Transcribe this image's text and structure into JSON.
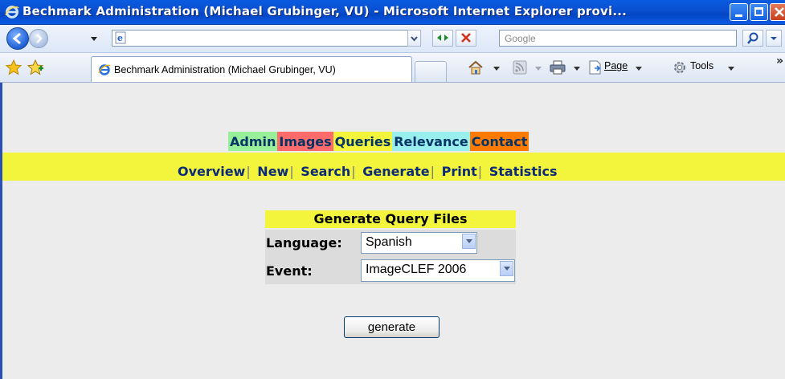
{
  "window": {
    "title": "Bechmark Administration (Michael Grubinger, VU) - Microsoft Internet Explorer provi...",
    "minimize_icon": "minimize-icon",
    "maximize_icon": "maximize-icon",
    "close_icon": "close-icon"
  },
  "addressbar": {
    "url": "",
    "search_placeholder": "Google"
  },
  "commandbar": {
    "tab_label": "Bechmark Administration (Michael Grubinger, VU)",
    "page_label": "Page",
    "tools_label": "Tools",
    "more_label": "»"
  },
  "menu": {
    "primary": [
      {
        "label": "Admin",
        "color": "#99ee99"
      },
      {
        "label": "Images",
        "color": "#ff6b6b"
      },
      {
        "label": "Queries",
        "color": "#f2f53b"
      },
      {
        "label": "Relevance",
        "color": "#99eeee"
      },
      {
        "label": "Contact",
        "color": "#ff7a00"
      }
    ],
    "secondary": [
      "Overview",
      "New",
      "Search",
      "Generate",
      "Print",
      "Statistics"
    ],
    "separator": "|"
  },
  "form": {
    "title": "Generate Query Files",
    "language_label": "Language:",
    "language_value": "Spanish",
    "event_label": "Event:",
    "event_value": "ImageCLEF 2006",
    "submit_label": "generate"
  },
  "colors": {
    "highlight_yellow": "#f2f53b",
    "title_blue": "#0a4fd0",
    "menu_text": "#0b2a78"
  }
}
